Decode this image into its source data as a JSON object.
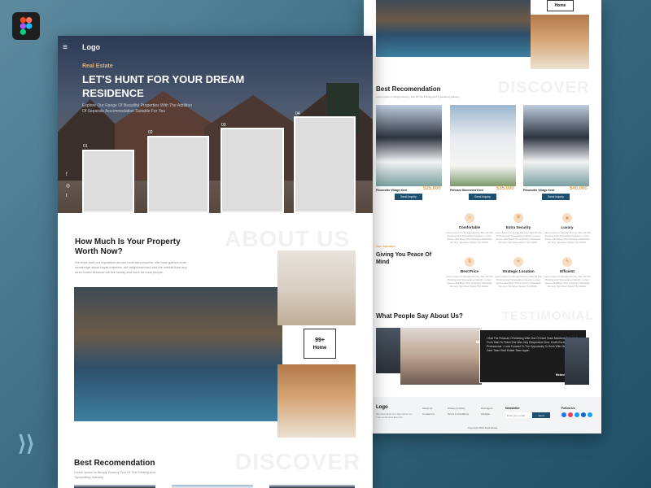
{
  "app": {
    "badge_icon": "figma-icon"
  },
  "front": {
    "menu_icon": "≡",
    "logo": "Logo",
    "eyebrow": "Real Estate",
    "title": "LET'S HUNT FOR YOUR DREAM RESIDENCE",
    "subtitle": "Explore Our Range Of Beautiful Properties With The Addition Of Separate Accommodation Suitable For You",
    "cards": [
      {
        "num": "01"
      },
      {
        "num": "02"
      },
      {
        "num": "03"
      },
      {
        "num": "04"
      }
    ],
    "socials": [
      "f",
      "◎",
      "t"
    ],
    "about": {
      "ghost": "ABOUT US",
      "title": "How Much Is Your Property Worth Now?",
      "body": "We have built our reputation as true local area experts. We have gained more knowledge about buyer interests, our neighbourhood and the market than any other brand because we live locally and work for local people.",
      "stat_value": "99+",
      "stat_label": "Home"
    },
    "recommend": {
      "ghost": "DISCOVER",
      "title": "Best Recomendation",
      "body": "Lorem Ipsum Is Simply Dummy Text Of The Printing And Typesetting Industry."
    }
  },
  "back": {
    "top_stat_label": "Home",
    "recommend": {
      "ghost": "DISCOVER",
      "title": "Best Recomendation",
      "body": "Lorem Ipsum Is Simply Dummy Text Of The Printing And Typesetting Industry.",
      "cards": [
        {
          "name": "Pleumville Village Kent",
          "price": "$25,000",
          "button": "Send Inquiry"
        },
        {
          "name": "Pennant Stoneview Kent",
          "price": "$35,000",
          "button": "Send Inquiry"
        },
        {
          "name": "Pleumville Village Kent",
          "price": "$40,000",
          "button": "Send Inquiry"
        }
      ]
    },
    "advantage": {
      "eyebrow": "Our Advante",
      "title": "Giving You Peace Of Mind",
      "features": [
        {
          "title": "Comfortable",
          "icon": "home-icon",
          "desc": "Lorem Ipsum Is Simply Dummy Text Of The Printing And Typesetting Industry. Lorem Ipsum Has Been The Industry's Standard Dummy Text Ever Since The 1500s."
        },
        {
          "title": "Extra Security",
          "icon": "shield-icon",
          "desc": "Lorem Ipsum Is Simply Dummy Text Of The Printing And Typesetting Industry. Lorem Ipsum Has Been The Industry's Standard Dummy Text Ever Since The 1500s."
        },
        {
          "title": "Luxury",
          "icon": "star-icon",
          "desc": "Lorem Ipsum Is Simply Dummy Text Of The Printing And Typesetting Industry. Lorem Ipsum Has Been The Industry's Standard Dummy Text Ever Since The 1500s."
        },
        {
          "title": "Best Price",
          "icon": "tag-icon",
          "desc": "Lorem Ipsum Is Simply Dummy Text Of The Printing And Typesetting Industry. Lorem Ipsum Has Been The Industry's Standard Dummy Text Ever Since The 1500s."
        },
        {
          "title": "Strategic Location",
          "icon": "pin-icon",
          "desc": "Lorem Ipsum Is Simply Dummy Text Of The Printing And Typesetting Industry. Lorem Ipsum Has Been The Industry's Standard Dummy Text Ever Since The 1500s."
        },
        {
          "title": "Efficient",
          "icon": "bolt-icon",
          "desc": "Lorem Ipsum Is Simply Dummy Text Of The Printing And Typesetting Industry. Lorem Ipsum Has Been The Industry's Standard Dummy Text Ever Since The 1500s."
        }
      ]
    },
    "testimonial": {
      "ghost": "TESTIMONIAL",
      "title": "What People Say About Us?",
      "quote": "I Had The Pleasure Of Working With One Of Zach Team Members Sally Hall. From Start To Finish She Was Very Responsive Kind. Knoth Excellent Professional. I Look Forward To The Opportunity To Work With Her And The Zach Team Real Estate Team Again",
      "author": "Melanie Kingsord"
    },
    "footer": {
      "logo": "Logo",
      "tagline": "We Have Built Our Reputation As True Local Area Experts.",
      "col1": [
        "About Us",
        "Contact Us"
      ],
      "col2": [
        "Privacy & Policy",
        "Terms & Conditions"
      ],
      "col3": [
        "Find Agent",
        "Lifestyle"
      ],
      "newsletter": "Newsletter",
      "email_placeholder": "Enter your email",
      "send": "Send",
      "follow": "Follow Us",
      "copyright": "Copyright 2022 Real Estate",
      "social_colors": [
        "#1877f2",
        "#e4405f",
        "#1d9bf0",
        "#0a66c2",
        "#1da1f2"
      ]
    }
  }
}
